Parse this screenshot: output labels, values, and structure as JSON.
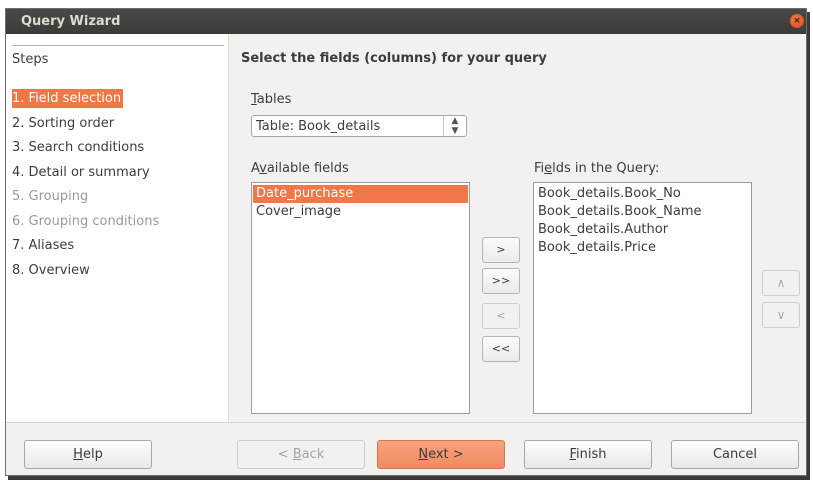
{
  "window": {
    "title": "Query Wizard",
    "close_glyph": "×"
  },
  "steps": {
    "title": "Steps",
    "items": [
      {
        "label": "1. Field selection",
        "state": "active"
      },
      {
        "label": "2. Sorting order",
        "state": "normal"
      },
      {
        "label": "3. Search conditions",
        "state": "normal"
      },
      {
        "label": "4. Detail or summary",
        "state": "normal"
      },
      {
        "label": "5. Grouping",
        "state": "disabled"
      },
      {
        "label": "6. Grouping conditions",
        "state": "disabled"
      },
      {
        "label": "7. Aliases",
        "state": "normal"
      },
      {
        "label": "8. Overview",
        "state": "normal"
      }
    ]
  },
  "main": {
    "heading": "Select the fields (columns) for your query",
    "tables_label_mnemonic": "T",
    "tables_label_rest": "ables",
    "table_select_value": "Table: Book_details",
    "available_label_pre": "A",
    "available_label_mnemonic": "v",
    "available_label_rest": "ailable fields",
    "available_fields": [
      {
        "label": "Date_purchase",
        "selected": true
      },
      {
        "label": "Cover_image",
        "selected": false
      }
    ],
    "query_label_pre": "Fi",
    "query_label_mnemonic": "e",
    "query_label_rest": "lds in the Query:",
    "query_fields": [
      "Book_details.Book_No",
      "Book_details.Book_Name",
      "Book_details.Author",
      "Book_details.Price"
    ],
    "move_buttons": {
      "add_one": ">",
      "add_all": ">>",
      "remove_one": "<",
      "remove_all": "<<"
    },
    "order_buttons": {
      "up": "∧",
      "down": "∨"
    }
  },
  "footer": {
    "help_mnemonic": "H",
    "help_rest": "elp",
    "back_prefix": "< ",
    "back_mnemonic": "B",
    "back_rest": "ack",
    "next_mnemonic": "N",
    "next_rest": "ext >",
    "finish_mnemonic": "F",
    "finish_rest": "inish",
    "cancel_label": "Cancel"
  },
  "colors": {
    "accent": "#f07746",
    "titlebar": "#3c3b37",
    "background": "#f2f1f0"
  }
}
